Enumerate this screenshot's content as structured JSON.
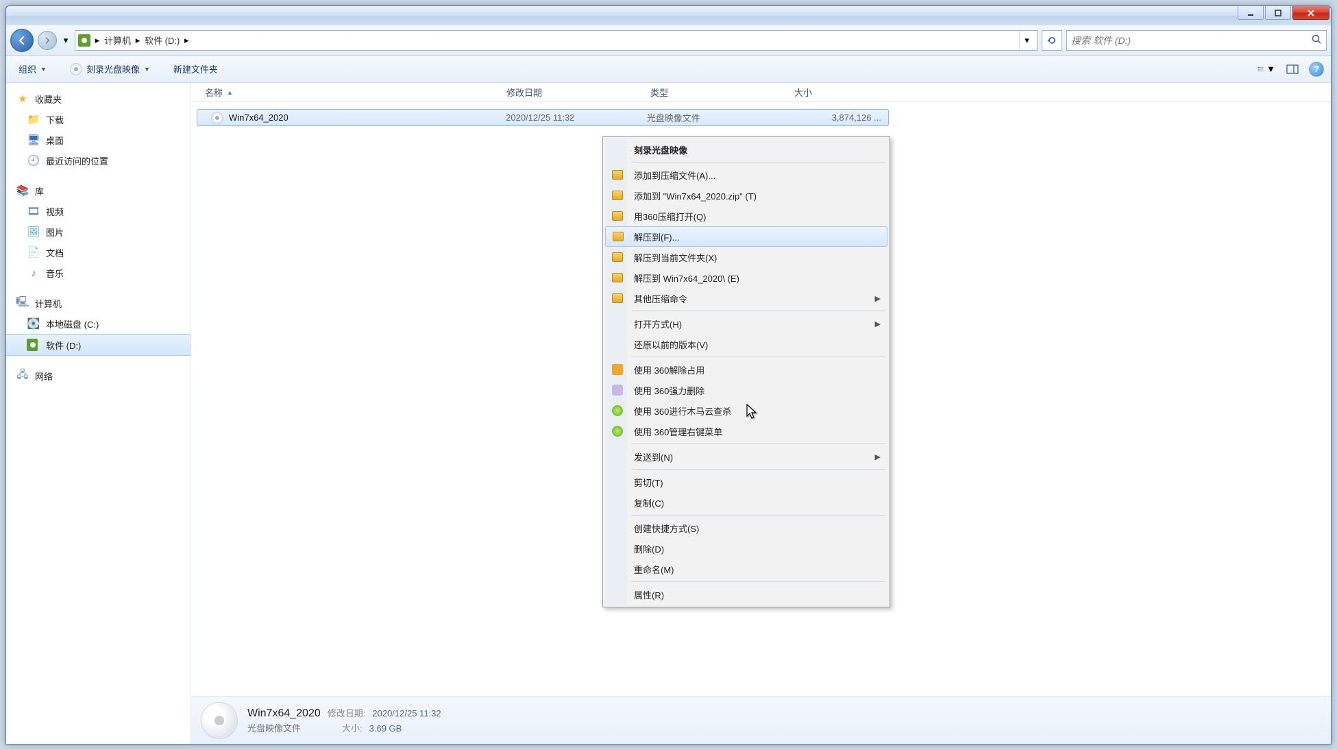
{
  "breadcrumb": {
    "root": "计算机",
    "current": "软件 (D:)"
  },
  "search": {
    "placeholder": "搜索 软件 (D:)"
  },
  "toolbar": {
    "organize": "组织",
    "burn": "刻录光盘映像",
    "newfolder": "新建文件夹"
  },
  "sidebar": {
    "favorites": {
      "label": "收藏夹",
      "items": [
        "下载",
        "桌面",
        "最近访问的位置"
      ]
    },
    "libraries": {
      "label": "库",
      "items": [
        "视频",
        "图片",
        "文档",
        "音乐"
      ]
    },
    "computer": {
      "label": "计算机",
      "items": [
        "本地磁盘 (C:)",
        "软件 (D:)"
      ]
    },
    "network": {
      "label": "网络"
    }
  },
  "columns": {
    "name": "名称",
    "date": "修改日期",
    "type": "类型",
    "size": "大小"
  },
  "file": {
    "name": "Win7x64_2020",
    "date": "2020/12/25 11:32",
    "type": "光盘映像文件",
    "size": "3,874,126 ..."
  },
  "context_menu": {
    "burn": "刻录光盘映像",
    "add_archive": "添加到压缩文件(A)...",
    "add_zip": "添加到 \"Win7x64_2020.zip\" (T)",
    "open_360zip": "用360压缩打开(Q)",
    "extract_to": "解压到(F)...",
    "extract_here": "解压到当前文件夹(X)",
    "extract_named": "解压到 Win7x64_2020\\ (E)",
    "other_zip": "其他压缩命令",
    "open_with": "打开方式(H)",
    "restore_prev": "还原以前的版本(V)",
    "unlock360": "使用 360解除占用",
    "forcedel360": "使用 360强力删除",
    "trojan360": "使用 360进行木马云查杀",
    "menu360": "使用 360管理右键菜单",
    "send_to": "发送到(N)",
    "cut": "剪切(T)",
    "copy": "复制(C)",
    "shortcut": "创建快捷方式(S)",
    "delete": "删除(D)",
    "rename": "重命名(M)",
    "properties": "属性(R)"
  },
  "details": {
    "title": "Win7x64_2020",
    "type": "光盘映像文件",
    "date_label": "修改日期:",
    "date": "2020/12/25 11:32",
    "size_label": "大小:",
    "size": "3.69 GB"
  }
}
